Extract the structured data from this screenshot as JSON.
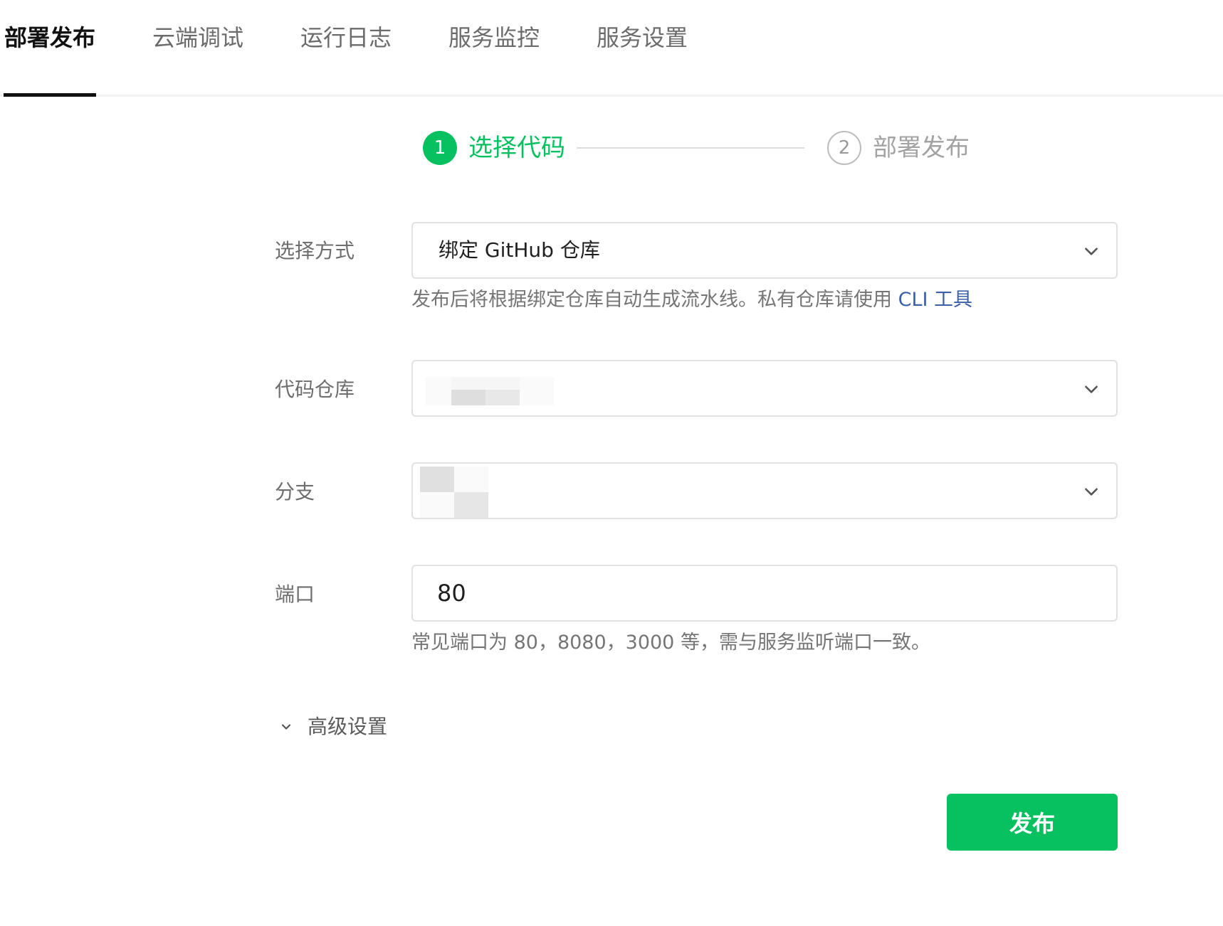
{
  "tabs": [
    {
      "label": "部署发布",
      "active": true
    },
    {
      "label": "云端调试",
      "active": false
    },
    {
      "label": "运行日志",
      "active": false
    },
    {
      "label": "服务监控",
      "active": false
    },
    {
      "label": "服务设置",
      "active": false
    }
  ],
  "steps": [
    {
      "number": "1",
      "label": "选择代码",
      "status": "current"
    },
    {
      "number": "2",
      "label": "部署发布",
      "status": "pending"
    }
  ],
  "form": {
    "method": {
      "label": "选择方式",
      "value": "绑定 GitHub 仓库",
      "hint": "发布后将根据绑定仓库自动生成流水线。私有仓库请使用 ",
      "hint_link": "CLI 工具"
    },
    "repo": {
      "label": "代码仓库",
      "value": ""
    },
    "branch": {
      "label": "分支",
      "value": ""
    },
    "port": {
      "label": "端口",
      "value": "80",
      "hint": "常见端口为 80，8080，3000 等，需与服务监听端口一致。"
    }
  },
  "advanced": {
    "label": "高级设置"
  },
  "publish": {
    "label": "发布"
  },
  "colors": {
    "accent": "#07c160",
    "link": "#3b5fa8"
  }
}
